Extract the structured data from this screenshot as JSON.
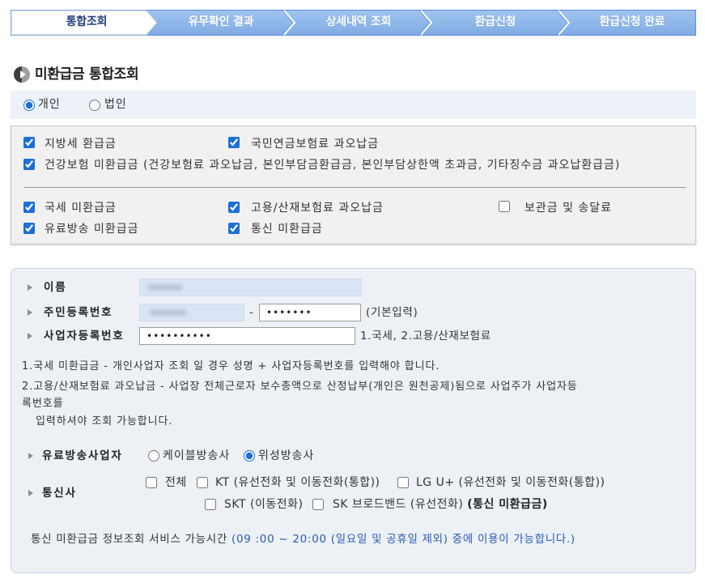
{
  "steps": {
    "items": [
      {
        "label": "통합조회",
        "active": true
      },
      {
        "label": "유무확인 결과",
        "active": false
      },
      {
        "label": "상세내역 조회",
        "active": false
      },
      {
        "label": "환급신청",
        "active": false
      },
      {
        "label": "환급신청 완료",
        "active": false
      }
    ]
  },
  "heading": {
    "title": "미환급금 통합조회",
    "icon": "section-marker-icon"
  },
  "applicant_type": {
    "options": [
      {
        "label": "개인",
        "checked": true
      },
      {
        "label": "법인",
        "checked": false
      }
    ]
  },
  "refund_types": {
    "items": [
      {
        "label": "지방세 환급금",
        "checked": true
      },
      {
        "label": "국민연금보험료 과오납금",
        "checked": true
      },
      {
        "label": "건강보험 미환급금 (건강보험료 과오납금, 본인부담금환급금, 본인부담상한액 초과금, 기타징수금 과오납환급금)",
        "checked": true
      },
      {
        "label": "국세 미환급금",
        "checked": true
      },
      {
        "label": "고용/산재보험료 과오납금",
        "checked": true
      },
      {
        "label": "보관금 및 송달료",
        "checked": false
      },
      {
        "label": "유료방송 미환급금",
        "checked": true
      },
      {
        "label": "통신 미환급금",
        "checked": true
      }
    ]
  },
  "form": {
    "bullet_icon": "triangle-right-icon",
    "name": {
      "label": "이름"
    },
    "rrn": {
      "label": "주민등록번호",
      "separator": "-",
      "back_value": "•••••••",
      "hint": "(기본입력)"
    },
    "brn": {
      "label": "사업자등록번호",
      "value": "••••••••••",
      "hint": "1.국세, 2.고용/산재보험료"
    },
    "notes": [
      "1.국세 미환급금 - 개인사업자 조회 일 경우 성명 + 사업자등록번호를 입력해야 합니다.",
      "2.고용/산재보험료 과오납금 - 사업장 전체근로자 보수총액으로 산정납부(개인은 원천공제)됨으로 사업주가 사업자등",
      "록번호를",
      "입력하셔야 조회 가능합니다."
    ],
    "broadcaster": {
      "label": "유료방송사업자",
      "options": [
        {
          "label": "케이블방송사",
          "checked": false
        },
        {
          "label": "위성방송사",
          "checked": true
        }
      ]
    },
    "telecom": {
      "label": "통신사",
      "options": [
        {
          "label": "전체",
          "checked": false
        },
        {
          "label": "KT (유선전화 및 이동전화(통합))",
          "checked": false
        },
        {
          "label": "LG U+ (유선전화 및 이동전화(통합))",
          "checked": false
        },
        {
          "label": "SKT (이동전화)",
          "checked": false
        },
        {
          "label": "SK 브로드밴드 (유선전화)",
          "checked": false
        }
      ],
      "suffix": "(통신 미환급금)"
    },
    "service_hours": {
      "text": "통신 미환급금 정보조회 서비스 가능시간",
      "highlight": "(09 :00 ~ 20:00 (일요일 및 공휴일 제외) 중에 이용이 가능합니다.)"
    }
  },
  "colors": {
    "step_blue": "#8db4e7",
    "accent": "#1c6fd8",
    "highlight_text": "#2a5cb0"
  }
}
